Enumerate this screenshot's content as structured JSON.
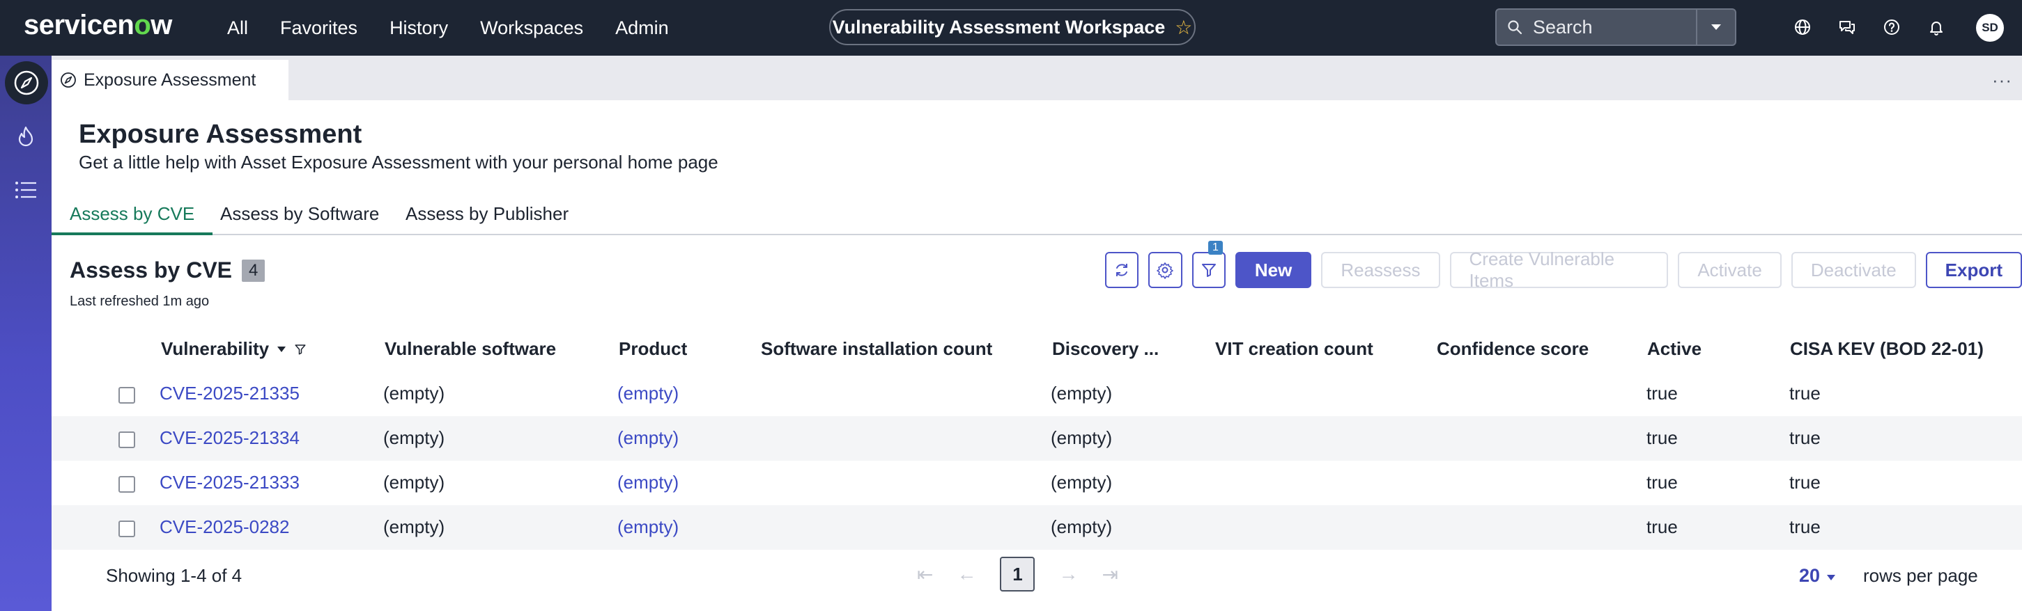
{
  "nav": {
    "logo_text": "servicenow",
    "links": [
      "All",
      "Favorites",
      "History",
      "Workspaces",
      "Admin"
    ],
    "workspace_title": "Vulnerability Assessment Workspace",
    "search_placeholder": "Search",
    "avatar_initials": "SD"
  },
  "tab": {
    "label": "Exposure Assessment"
  },
  "page": {
    "title": "Exposure Assessment",
    "subtitle": "Get a little help with Asset Exposure Assessment with your personal home page"
  },
  "subtabs": [
    "Assess by CVE",
    "Assess by Software",
    "Assess by Publisher"
  ],
  "list": {
    "title": "Assess by CVE",
    "count": "4",
    "last_refreshed": "Last refreshed 1m ago",
    "filter_count": "1",
    "buttons": {
      "new": "New",
      "reassess": "Reassess",
      "create_vit": "Create Vulnerable Items",
      "activate": "Activate",
      "deactivate": "Deactivate",
      "export": "Export"
    }
  },
  "table": {
    "columns": [
      "Vulnerability",
      "Vulnerable software",
      "Product",
      "Software installation count",
      "Discovery ...",
      "VIT creation count",
      "Confidence score",
      "Active",
      "CISA KEV (BOD 22-01)"
    ],
    "rows": [
      {
        "vulnerability": "CVE-2025-21335",
        "software": "(empty)",
        "product": "(empty)",
        "discovery": "(empty)",
        "active": "true",
        "cisa": "true"
      },
      {
        "vulnerability": "CVE-2025-21334",
        "software": "(empty)",
        "product": "(empty)",
        "discovery": "(empty)",
        "active": "true",
        "cisa": "true"
      },
      {
        "vulnerability": "CVE-2025-21333",
        "software": "(empty)",
        "product": "(empty)",
        "discovery": "(empty)",
        "active": "true",
        "cisa": "true"
      },
      {
        "vulnerability": "CVE-2025-0282",
        "software": "(empty)",
        "product": "(empty)",
        "discovery": "(empty)",
        "active": "true",
        "cisa": "true"
      }
    ]
  },
  "footer": {
    "showing": "Showing 1-4 of 4",
    "current_page": "1",
    "rows_per_page_value": "20",
    "rows_per_page_label": "rows per page"
  },
  "colors": {
    "nav_bg": "#1d2533",
    "primary": "#4d55c8",
    "active_tab": "#177a5b",
    "link": "#3b49c4"
  }
}
